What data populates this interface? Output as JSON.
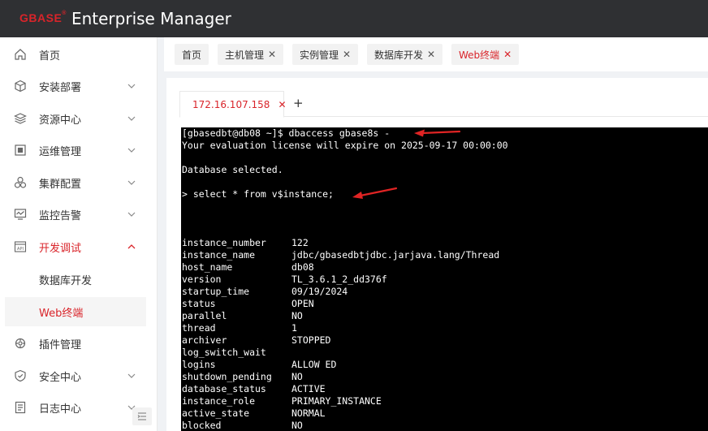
{
  "header": {
    "logo": "GBASE",
    "logo_mark": "®",
    "title": "Enterprise Manager"
  },
  "sidebar": {
    "items": [
      {
        "label": "首页",
        "icon": "home-icon"
      },
      {
        "label": "安装部署",
        "icon": "cube-icon"
      },
      {
        "label": "资源中心",
        "icon": "layers-icon"
      },
      {
        "label": "运维管理",
        "icon": "chip-icon"
      },
      {
        "label": "集群配置",
        "icon": "cluster-icon"
      },
      {
        "label": "监控告警",
        "icon": "monitor-icon"
      },
      {
        "label": "开发调试",
        "icon": "api-icon"
      },
      {
        "label": "插件管理",
        "icon": "plugin-icon"
      },
      {
        "label": "安全中心",
        "icon": "shield-icon"
      },
      {
        "label": "日志中心",
        "icon": "log-icon"
      }
    ],
    "sub_items": [
      {
        "label": "数据库开发"
      },
      {
        "label": "Web终端"
      }
    ]
  },
  "tabs": [
    {
      "label": "首页",
      "closable": false
    },
    {
      "label": "主机管理",
      "closable": true
    },
    {
      "label": "实例管理",
      "closable": true
    },
    {
      "label": "数据库开发",
      "closable": true
    },
    {
      "label": "Web终端",
      "closable": true
    }
  ],
  "close_glyph": "✕",
  "terminal_tab": {
    "label": "172.16.107.158",
    "add": "+"
  },
  "terminal": {
    "lines": [
      "[gbasedbt@db08 ~]$ dbaccess gbase8s -",
      "Your evaluation license will expire on 2025-09-17 00:00:00",
      "Database selected.",
      "> select * from v$instance;"
    ],
    "rows": [
      {
        "key": "instance_number",
        "value": "122"
      },
      {
        "key": "instance_name",
        "value": "jdbc/gbasedbtjdbc.jarjava.lang/Thread"
      },
      {
        "key": "host_name",
        "value": "db08"
      },
      {
        "key": "version",
        "value": "TL_3.6.1_2_dd376f"
      },
      {
        "key": "startup_time",
        "value": "09/19/2024"
      },
      {
        "key": "status",
        "value": "OPEN"
      },
      {
        "key": "parallel",
        "value": "NO"
      },
      {
        "key": "thread",
        "value": "1"
      },
      {
        "key": "archiver",
        "value": "STOPPED"
      },
      {
        "key": "log_switch_wait",
        "value": ""
      },
      {
        "key": "logins",
        "value": "ALLOW ED"
      },
      {
        "key": "shutdown_pending",
        "value": "NO"
      },
      {
        "key": "database_status",
        "value": "ACTIVE"
      },
      {
        "key": "instance_role",
        "value": "PRIMARY_INSTANCE"
      },
      {
        "key": "active_state",
        "value": "NORMAL"
      },
      {
        "key": "blocked",
        "value": "NO"
      }
    ]
  },
  "colors": {
    "accent": "#d9242a",
    "header_bg": "#2f3033",
    "terminal_bg": "#000000"
  }
}
